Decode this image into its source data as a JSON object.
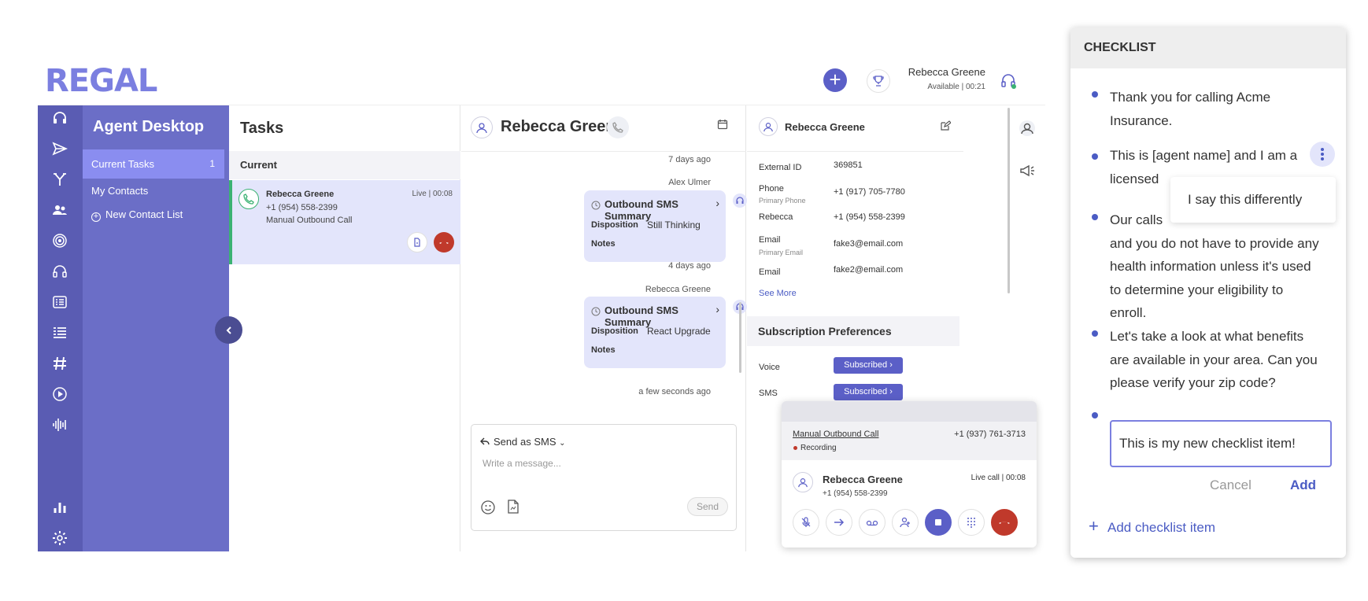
{
  "brand": {
    "logo": "REGAL",
    "accent": "#5b5fc7",
    "nav_bg": "#6b6ec7"
  },
  "topbar": {
    "user_name": "Rebecca Greene",
    "status": "Available",
    "timer": "00:21"
  },
  "sidebar": {
    "title": "Agent Desktop",
    "items": [
      {
        "label": "Current Tasks",
        "count": "1"
      },
      {
        "label": "My Contacts"
      },
      {
        "label": "New Contact List"
      }
    ]
  },
  "tasks": {
    "title": "Tasks",
    "section": "Current",
    "card": {
      "name": "Rebecca Greene",
      "phone": "+1 (954) 558-2399",
      "type": "Manual Outbound Call",
      "status": "Live",
      "time": "00:08"
    }
  },
  "conversation": {
    "contact": "Rebecca Greene",
    "ts1": "7 days ago",
    "sender1": "Alex Ulmer",
    "msg1": {
      "title": "Outbound SMS Summary",
      "disp_label": "Disposition",
      "disp_value": "Still Thinking",
      "notes_label": "Notes"
    },
    "ts2": "4 days ago",
    "sender2": "Rebecca Greene",
    "msg2": {
      "title": "Outbound SMS Summary",
      "disp_label": "Disposition",
      "disp_value": "React Upgrade",
      "notes_label": "Notes"
    },
    "ts3": "a few seconds ago",
    "composer": {
      "mode": "Send as SMS",
      "placeholder": "Write a message...",
      "send": "Send"
    }
  },
  "details": {
    "name": "Rebecca Greene",
    "fields": [
      {
        "label": "External ID",
        "value": "369851"
      },
      {
        "label": "Phone",
        "sub": "Primary Phone",
        "value": "+1 (917) 705-7780"
      },
      {
        "label": "Rebecca",
        "value": "+1 (954) 558-2399"
      },
      {
        "label": "Email",
        "sub": "Primary Email",
        "value": "fake3@email.com"
      },
      {
        "label": "Email",
        "value": "fake2@email.com"
      }
    ],
    "see_more": "See More",
    "subscription_title": "Subscription Preferences",
    "subs": [
      {
        "label": "Voice",
        "value": "Subscribed"
      },
      {
        "label": "SMS",
        "value": "Subscribed"
      }
    ]
  },
  "call": {
    "type": "Manual Outbound Call",
    "number": "+1 (937) 761-3713",
    "recording": "Recording",
    "contact": "Rebecca Greene",
    "phone": "+1 (954) 558-2399",
    "status": "Live call",
    "time": "00:08"
  },
  "checklist": {
    "title": "CHECKLIST",
    "items": [
      "Thank you for calling Acme Insurance.",
      "This is [agent name] and I am a licensed",
      "Our calls",
      "and you do not have to provide any health information unless it's used to determine your eligibility to enroll.",
      "Let's take a look at what benefits are available in your area. Can you please verify your zip code?"
    ],
    "menu_option": "I say this differently",
    "new_item_value": "This is my new checklist item!",
    "cancel": "Cancel",
    "add": "Add",
    "add_item": "Add checklist item"
  }
}
